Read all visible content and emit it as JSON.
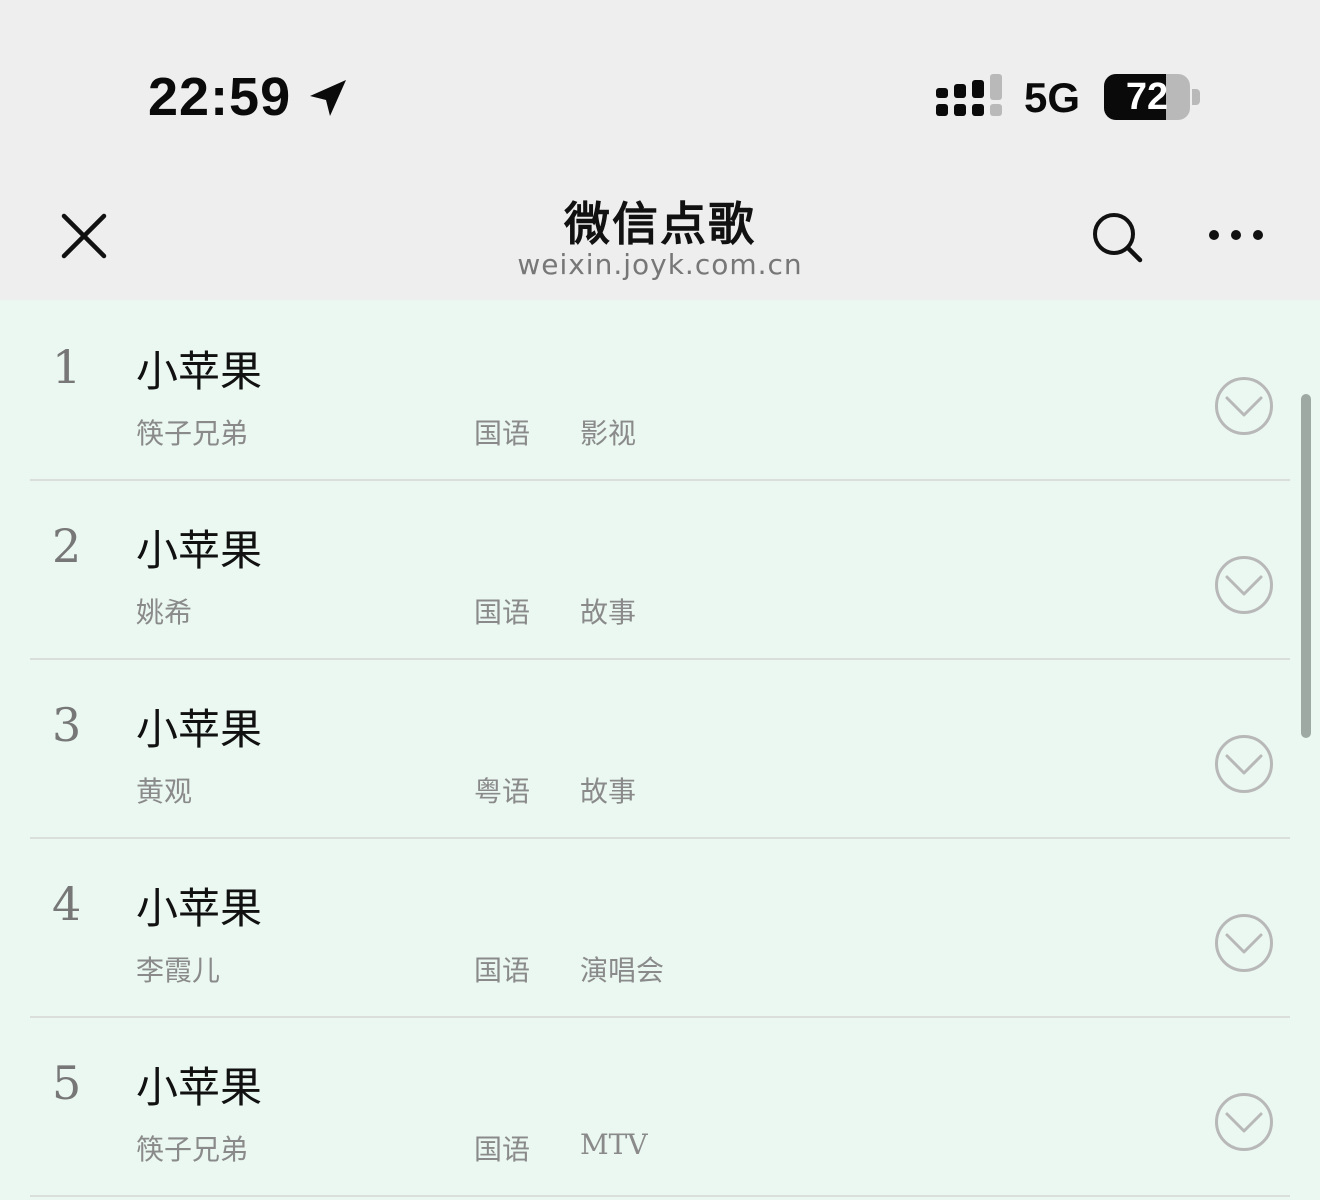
{
  "status_bar": {
    "time": "22:59",
    "network": "5G",
    "battery_percent": "72",
    "battery_level": 0.72
  },
  "nav": {
    "title": "微信点歌",
    "subtitle": "weixin.joyk.com.cn",
    "icons": [
      "close-icon",
      "search-icon",
      "more-icon"
    ]
  },
  "songs": [
    {
      "index": "1",
      "title": "小苹果",
      "artist": "筷子兄弟",
      "language": "国语",
      "tag": "影视"
    },
    {
      "index": "2",
      "title": "小苹果",
      "artist": "姚希",
      "language": "国语",
      "tag": "故事"
    },
    {
      "index": "3",
      "title": "小苹果",
      "artist": "黄观",
      "language": "粤语",
      "tag": "故事"
    },
    {
      "index": "4",
      "title": "小苹果",
      "artist": "李霞儿",
      "language": "国语",
      "tag": "演唱会"
    },
    {
      "index": "5",
      "title": "小苹果",
      "artist": "筷子兄弟",
      "language": "国语",
      "tag": "MTV"
    }
  ],
  "colors": {
    "list_background": "#EAF8F1",
    "header_background": "#EEEEEE",
    "secondary_text": "#8a8a8a"
  }
}
